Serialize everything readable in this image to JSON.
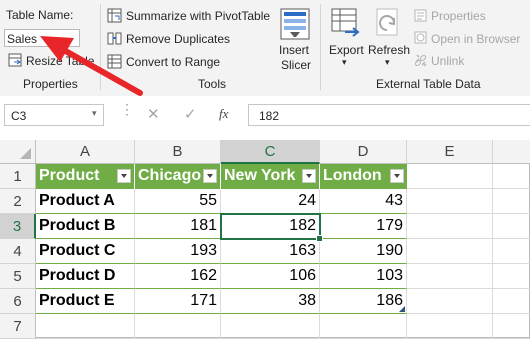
{
  "ribbon": {
    "properties": {
      "table_name_label": "Table Name:",
      "table_name_value": "Sales",
      "resize_label": "Resize Table",
      "group_label": "Properties"
    },
    "tools": {
      "summarize_label": "Summarize with PivotTable",
      "remove_duplicates_label": "Remove Duplicates",
      "convert_label": "Convert to Range",
      "insert_slicer_line1": "Insert",
      "insert_slicer_line2": "Slicer",
      "group_label": "Tools"
    },
    "external": {
      "export_label": "Export",
      "refresh_label": "Refresh",
      "properties_label": "Properties",
      "open_browser_label": "Open in Browser",
      "unlink_label": "Unlink",
      "group_label": "External Table Data"
    }
  },
  "formula_bar": {
    "name_box": "C3",
    "fx_label": "fx",
    "formula_value": "182"
  },
  "columns": [
    "A",
    "B",
    "C",
    "D",
    "E"
  ],
  "rows": [
    "1",
    "2",
    "3",
    "4",
    "5",
    "6",
    "7"
  ],
  "table": {
    "headers": [
      "Product",
      "Chicago",
      "New York",
      "London"
    ],
    "data": [
      [
        "Product A",
        "55",
        "24",
        "43"
      ],
      [
        "Product B",
        "181",
        "182",
        "179"
      ],
      [
        "Product C",
        "193",
        "163",
        "190"
      ],
      [
        "Product D",
        "162",
        "106",
        "103"
      ],
      [
        "Product E",
        "171",
        "38",
        "186"
      ]
    ]
  },
  "active_cell": "C3",
  "colors": {
    "table_header": "#70ad47",
    "annotation_arrow": "#e8262a",
    "selection": "#217346"
  }
}
